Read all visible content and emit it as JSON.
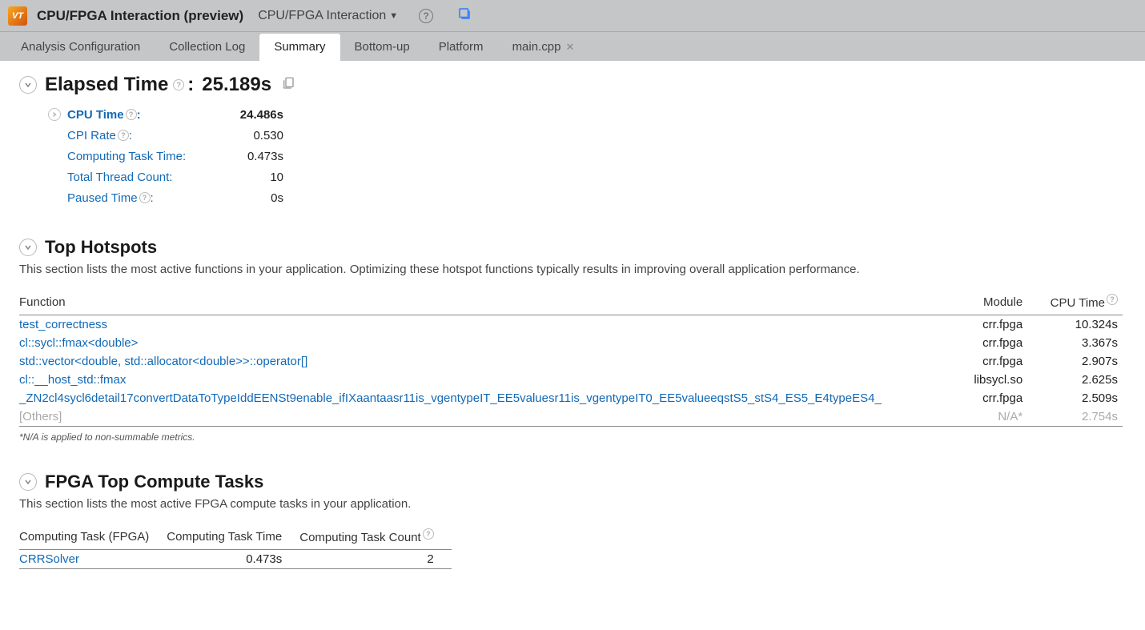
{
  "topbar": {
    "title": "CPU/FPGA Interaction (preview)",
    "dropdown_label": "CPU/FPGA Interaction"
  },
  "tabs": [
    {
      "label": "Analysis Configuration",
      "active": false,
      "closable": false
    },
    {
      "label": "Collection Log",
      "active": false,
      "closable": false
    },
    {
      "label": "Summary",
      "active": true,
      "closable": false
    },
    {
      "label": "Bottom-up",
      "active": false,
      "closable": false
    },
    {
      "label": "Platform",
      "active": false,
      "closable": false
    },
    {
      "label": "main.cpp",
      "active": false,
      "closable": true
    }
  ],
  "elapsed": {
    "title_prefix": "Elapsed Time",
    "title_value": "25.189s",
    "metrics": [
      {
        "label": "CPU Time",
        "value": "24.486s",
        "help": true,
        "bold": true,
        "expandable": true
      },
      {
        "label": "CPI Rate",
        "value": "0.530",
        "help": true,
        "bold": false,
        "expandable": false
      },
      {
        "label": "Computing Task Time:",
        "value": "0.473s",
        "help": false,
        "bold": false,
        "expandable": false
      },
      {
        "label": "Total Thread Count:",
        "value": "10",
        "help": false,
        "bold": false,
        "expandable": false
      },
      {
        "label": "Paused Time",
        "value": "0s",
        "help": true,
        "bold": false,
        "expandable": false
      }
    ]
  },
  "hotspots": {
    "title": "Top Hotspots",
    "description": "This section lists the most active functions in your application. Optimizing these hotspot functions typically results in improving overall application performance.",
    "columns": {
      "function": "Function",
      "module": "Module",
      "cpu_time": "CPU Time"
    },
    "rows": [
      {
        "function": "test_correctness",
        "module": "crr.fpga",
        "cpu_time": "10.324s",
        "muted": false
      },
      {
        "function": "cl::sycl::fmax<double>",
        "module": "crr.fpga",
        "cpu_time": "3.367s",
        "muted": false
      },
      {
        "function": "std::vector<double, std::allocator<double>>::operator[]",
        "module": "crr.fpga",
        "cpu_time": "2.907s",
        "muted": false
      },
      {
        "function": "cl::__host_std::fmax",
        "module": "libsycl.so",
        "cpu_time": "2.625s",
        "muted": false
      },
      {
        "function": "_ZN2cl4sycl6detail17convertDataToTypeIddEENSt9enable_ifIXaantaasr11is_vgentypeIT_EE5valuesr11is_vgentypeIT0_EE5valueeqstS5_stS4_ES5_E4typeES4_",
        "module": "crr.fpga",
        "cpu_time": "2.509s",
        "muted": false
      },
      {
        "function": "[Others]",
        "module": "N/A*",
        "cpu_time": "2.754s",
        "muted": true
      }
    ],
    "footnote": "*N/A is applied to non-summable metrics."
  },
  "fpga": {
    "title": "FPGA Top Compute Tasks",
    "description": "This section lists the most active FPGA compute tasks in your application.",
    "columns": {
      "task": "Computing Task (FPGA)",
      "time": "Computing Task Time",
      "count": "Computing Task Count"
    },
    "rows": [
      {
        "task": "CRRSolver",
        "time": "0.473s",
        "count": "2"
      }
    ]
  }
}
